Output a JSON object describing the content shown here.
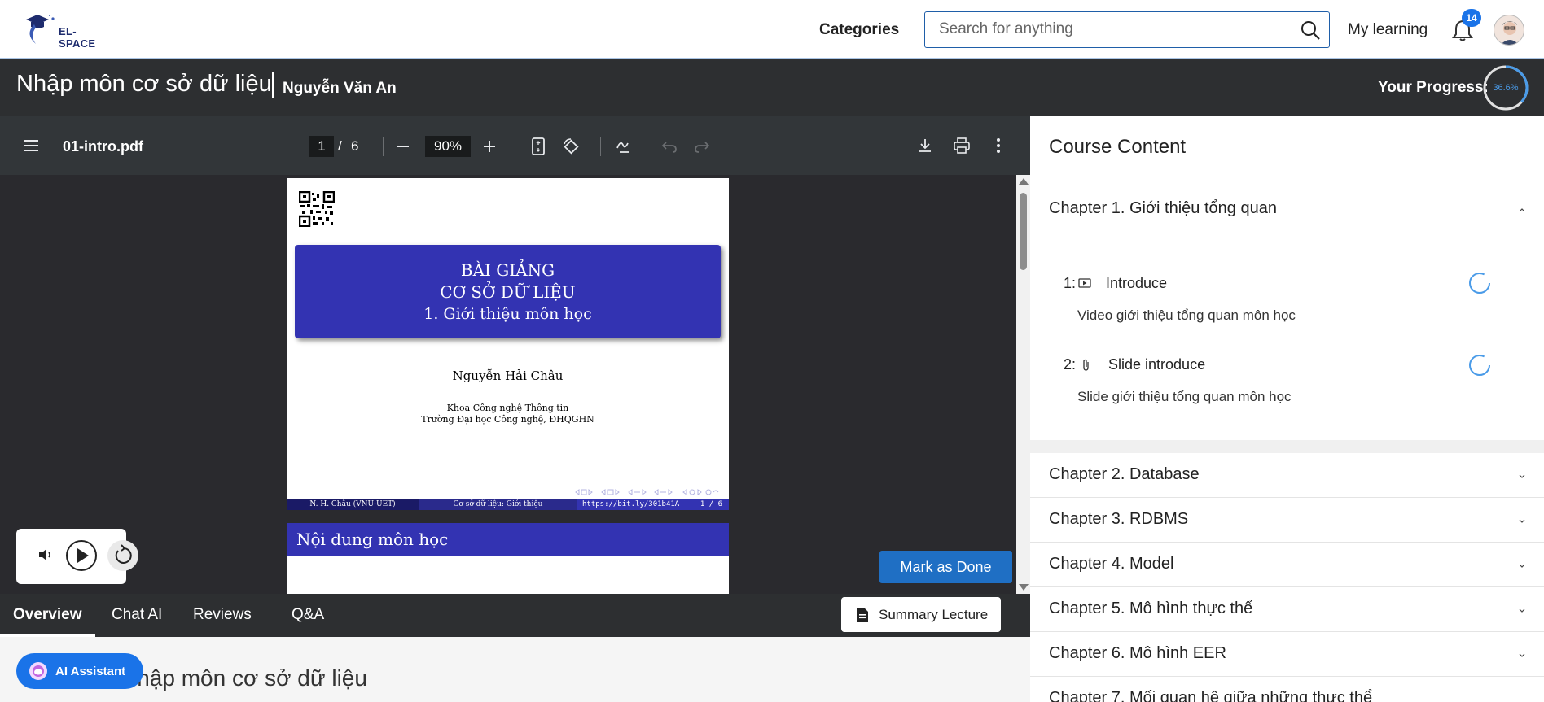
{
  "nav": {
    "logo_text": "EL-SPACE",
    "categories": "Categories",
    "search_placeholder": "Search for anything",
    "my_learning": "My learning",
    "notification_count": "14"
  },
  "course": {
    "title": "Nhập môn cơ sở dữ liệu",
    "author": "Nguyễn Văn An",
    "progress_label": "Your Progress:",
    "progress_text": "36.6%",
    "progress_value": 0.366
  },
  "viewer": {
    "filename": "01-intro.pdf",
    "current_page": "1",
    "page_sep": "/",
    "total_pages": "6",
    "zoom": "90%"
  },
  "slide": {
    "title_line1": "BÀI GIẢNG",
    "title_line2": "CƠ SỞ DỮ LIỆU",
    "title_line3": "1.  Giới thiệu môn học",
    "author": "Nguyễn Hải Châu",
    "institution1": "Khoa Công nghệ Thông tin",
    "institution2": "Trường Đại học Công nghệ, ĐHQGHN",
    "footer_author": "N. H. Châu (VNU-UET)",
    "footer_topic": "Cơ sở dữ liệu: Giới thiệu",
    "footer_link": "https://bit.ly/301b41A",
    "footer_page": "1 / 6",
    "page2_heading": "Nội dung môn học"
  },
  "actions": {
    "mark_done": "Mark as Done",
    "summary": "Summary Lecture",
    "ai_assistant": "AI Assistant"
  },
  "tabs": [
    "Overview",
    "Chat AI",
    "Reviews",
    "Q&A"
  ],
  "overview_title": "Nhập môn cơ sở dữ liệu",
  "sidebar": {
    "title": "Course Content",
    "chapter1": {
      "title": "Chapter 1. Giới thiệu tổng quan",
      "lessons": [
        {
          "num": "1:",
          "name": "Introduce",
          "desc": "Video giới thiệu tổng quan môn học",
          "icon": "video-icon"
        },
        {
          "num": "2:",
          "name": "Slide introduce",
          "desc": "Slide giới thiệu tổng quan môn học",
          "icon": "paperclip-icon"
        }
      ]
    },
    "chapters": [
      "Chapter 2. Database",
      "Chapter 3. RDBMS",
      "Chapter 4. Model",
      "Chapter 5. Mô hình thực thể",
      "Chapter 6. Mô hình EER",
      "Chapter 7. Mối quan hệ giữa những thực thể"
    ]
  },
  "colors": {
    "accent": "#1a73e8",
    "dark_bar": "#2d2f31",
    "slide_blue": "#3333b2"
  }
}
